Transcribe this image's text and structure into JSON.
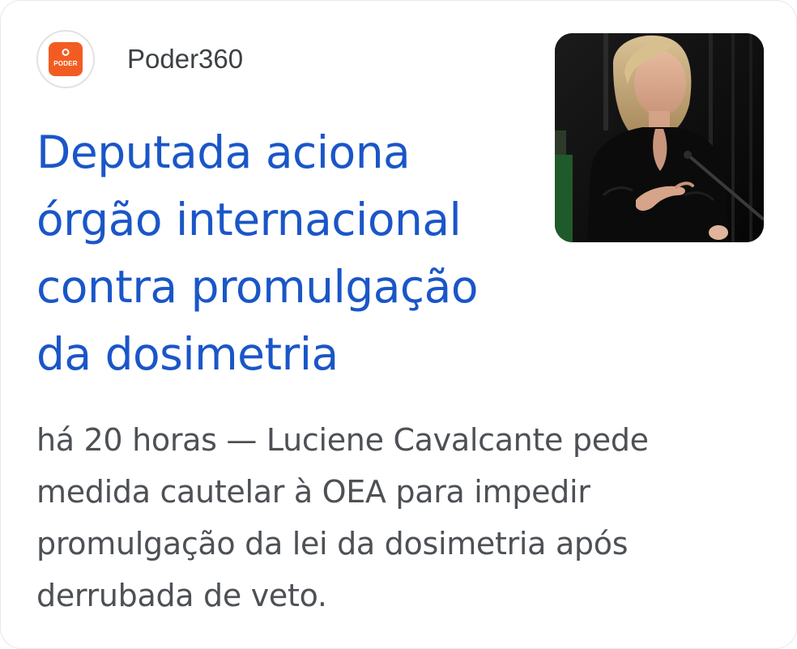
{
  "source": {
    "name": "Poder360",
    "logo_text": "PODER"
  },
  "article": {
    "headline": "Deputada aciona órgão internacional contra promulgação da dosimetria",
    "timestamp": "há 20 horas",
    "separator": " — ",
    "snippet": "Luciene Cavalcante pede medida cautelar à OEA para impedir promulgação da lei da dosimetria após derrubada de veto."
  },
  "thumbnail": {
    "icon": "photo-woman-speaking-at-microphone"
  },
  "colors": {
    "headline": "#1a56c8",
    "logo_bg": "#f25c22",
    "source_text": "#3c4043",
    "snippet_text": "#4d5156"
  }
}
